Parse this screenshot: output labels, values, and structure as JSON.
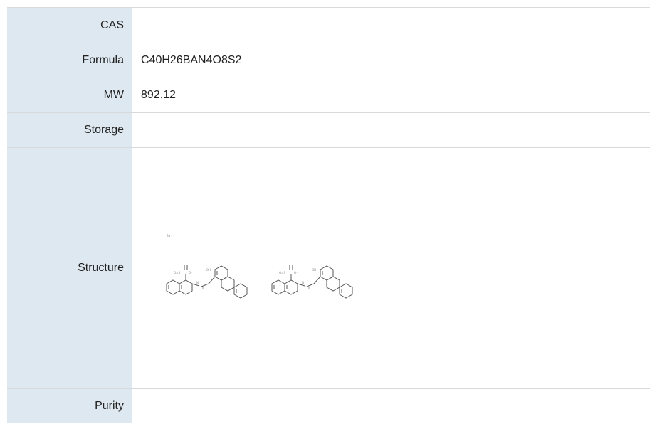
{
  "properties": {
    "cas": {
      "label": "CAS",
      "value": ""
    },
    "formula": {
      "label": "Formula",
      "value": "C40H26BAN4O8S2"
    },
    "mw": {
      "label": "MW",
      "value": "892.12"
    },
    "storage": {
      "label": "Storage",
      "value": ""
    },
    "structure": {
      "label": "Structure"
    },
    "purity": {
      "label": "Purity",
      "value": ""
    }
  }
}
